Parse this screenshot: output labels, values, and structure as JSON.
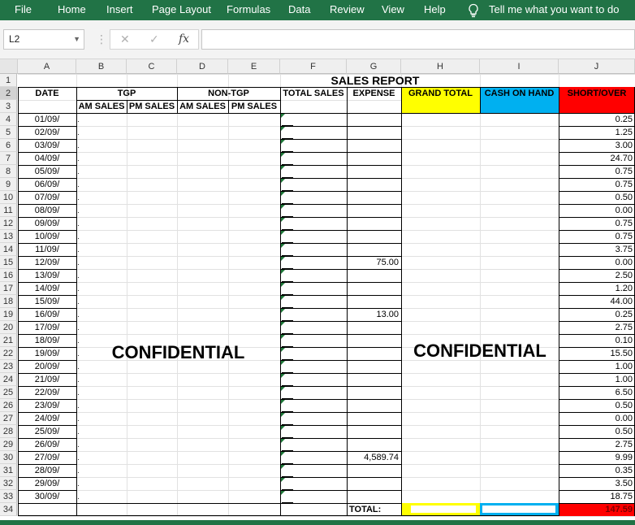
{
  "menu": {
    "file": "File",
    "home": "Home",
    "insert": "Insert",
    "page_layout": "Page Layout",
    "formulas": "Formulas",
    "data": "Data",
    "review": "Review",
    "view": "View",
    "help": "Help",
    "tell_me": "Tell me what you want to do"
  },
  "namebox": "L2",
  "formula_bar": {
    "fx": "fx",
    "cancel": "✕",
    "enter": "✓",
    "content": ""
  },
  "columns": [
    "A",
    "B",
    "C",
    "D",
    "E",
    "F",
    "G",
    "H",
    "I",
    "J"
  ],
  "rows": [
    "1",
    "2",
    "3",
    "4",
    "5",
    "6",
    "7",
    "8",
    "9",
    "10",
    "11",
    "12",
    "13",
    "14",
    "15",
    "16",
    "17",
    "18",
    "19",
    "20",
    "21",
    "22",
    "23",
    "24",
    "25",
    "26",
    "27",
    "28",
    "29",
    "30",
    "31",
    "32",
    "33",
    "34"
  ],
  "report": {
    "title": "SALES REPORT",
    "date": "DATE",
    "tgp": "TGP",
    "non_tgp": "NON-TGP",
    "am_sales": "AM SALES",
    "pm_sales": "PM SALES",
    "total_sales": "TOTAL SALES",
    "expense": "EXPENSE",
    "grand_total": "GRAND TOTAL",
    "cash_on_hand": "CASH ON HAND",
    "short_over": "SHORT/OVER",
    "confidential_left": "CONFIDENTIAL",
    "confidential_right": "CONFIDENTIAL",
    "total_label": "TOTAL:",
    "total_short_over": "147.59"
  },
  "dates": [
    "01/09/",
    "02/09/",
    "03/09/",
    "04/09/",
    "05/09/",
    "06/09/",
    "07/09/",
    "08/09/",
    "09/09/",
    "10/09/",
    "11/09/",
    "12/09/",
    "13/09/",
    "14/09/",
    "15/09/",
    "16/09/",
    "17/09/",
    "18/09/",
    "19/09/",
    "20/09/",
    "21/09/",
    "22/09/",
    "23/09/",
    "24/09/",
    "25/09/",
    "26/09/",
    "27/09/",
    "28/09/",
    "29/09/",
    "30/09/"
  ],
  "expenses": [
    "",
    "",
    "",
    "",
    "",
    "",
    "",
    "",
    "",
    "",
    "",
    "75.00",
    "",
    "",
    "",
    "13.00",
    "",
    "",
    "",
    "",
    "",
    "",
    "",
    "",
    "",
    "",
    "4,589.74",
    "",
    "",
    ""
  ],
  "short_over_values": [
    "0.25",
    "1.25",
    "3.00",
    "24.70",
    "0.75",
    "0.75",
    "0.50",
    "0.00",
    "0.75",
    "0.75",
    "3.75",
    "0.00",
    "2.50",
    "1.20",
    "44.00",
    "0.25",
    "2.75",
    "0.10",
    "15.50",
    "1.00",
    "1.00",
    "6.50",
    "0.50",
    "0.00",
    "0.50",
    "2.75",
    "9.99",
    "0.35",
    "3.50",
    "18.75"
  ],
  "colors": {
    "ribbon": "#217346",
    "grand_total": "#ffff00",
    "cash_on_hand": "#00b0f0",
    "short_over": "#ff0000"
  }
}
